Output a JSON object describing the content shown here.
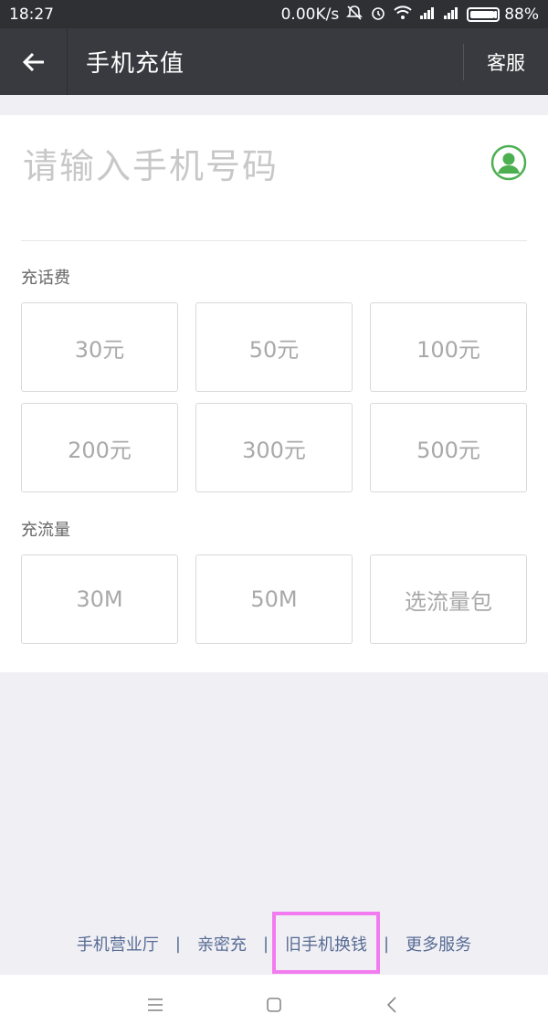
{
  "status_bar": {
    "time": "18:27",
    "network_speed": "0.00K/s",
    "battery": "88%",
    "icons": [
      "mute-bell-icon",
      "alarm-icon",
      "wifi-icon",
      "signal-icon",
      "signal-icon",
      "battery-icon"
    ]
  },
  "nav": {
    "title": "手机充值",
    "service_label": "客服"
  },
  "phone": {
    "placeholder": "请输入手机号码",
    "value": ""
  },
  "recharge": {
    "label": "充话费",
    "options": [
      "30元",
      "50元",
      "100元",
      "200元",
      "300元",
      "500元"
    ]
  },
  "data_plan": {
    "label": "充流量",
    "options": [
      "30M",
      "50M",
      "选流量包"
    ]
  },
  "bottom_links": [
    "手机营业厅",
    "亲密充",
    "旧手机换钱",
    "更多服务"
  ],
  "colors": {
    "nav_bg": "#393a3f",
    "status_bg": "#2f3034",
    "link_color": "#586c94",
    "highlight": "#f27bf0",
    "contact_green": "#4caf50"
  }
}
